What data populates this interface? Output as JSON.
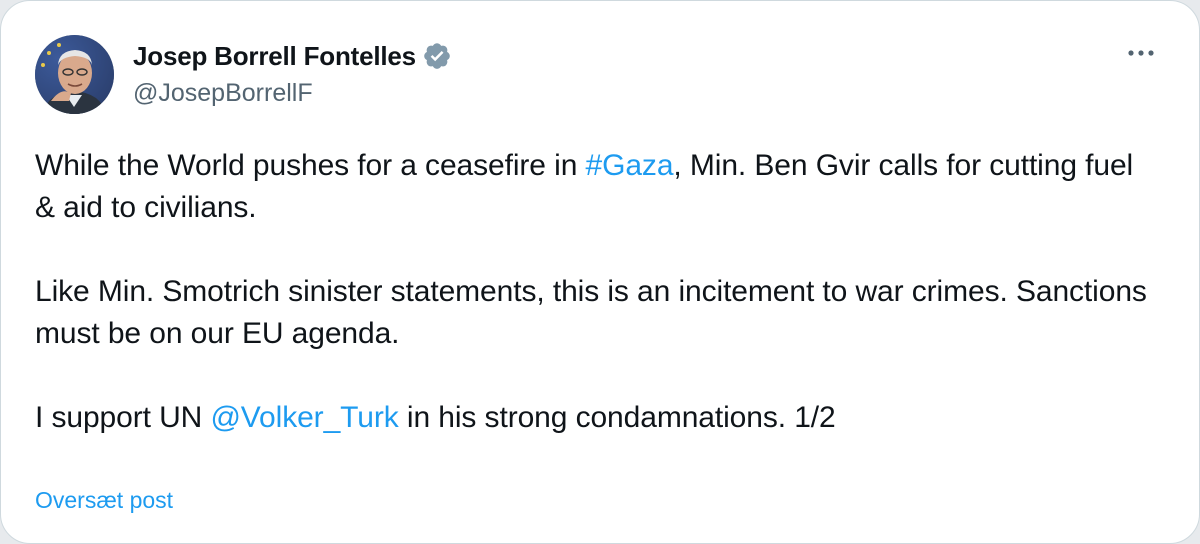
{
  "author": {
    "display_name": "Josep Borrell Fontelles",
    "handle": "@JosepBorrellF",
    "verified_badge_icon": "verified-badge-icon",
    "badge_color": "#829aab",
    "avatar_icon": "avatar-photo"
  },
  "menu": {
    "more_icon": "more-options-icon"
  },
  "tweet": {
    "para1": {
      "before": "While the World pushes for a ceasefire in ",
      "hashtag": "#Gaza",
      "after": ", Min. Ben Gvir calls for cutting fuel & aid to civilians."
    },
    "para2": "Like Min. Smotrich sinister statements, this is an incitement to war crimes. Sanctions must be on our EU agenda.",
    "para3": {
      "before": "I support UN ",
      "mention": "@Volker_Turk",
      "after": " in his strong condamnations. 1/2"
    }
  },
  "translate_label": "Oversæt post",
  "colors": {
    "text": "#0f1419",
    "secondary": "#536471",
    "link": "#1d9bf0",
    "border": "#cfd9de"
  }
}
